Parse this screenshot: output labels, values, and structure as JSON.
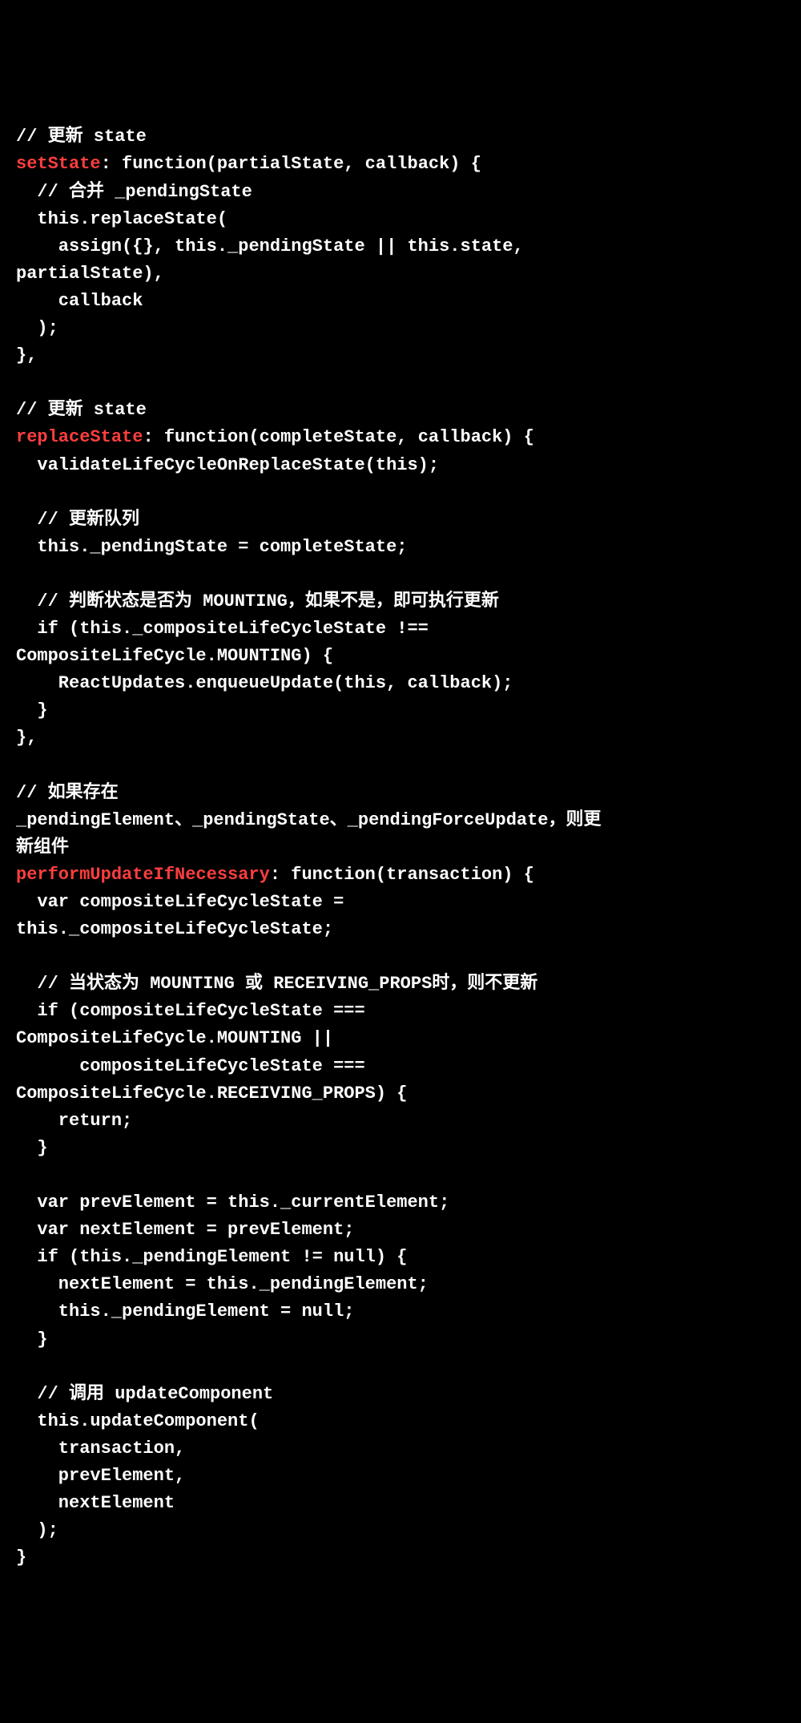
{
  "code": {
    "lines": [
      {
        "type": "comment",
        "text": "// 更新 state"
      },
      {
        "type": "method-decl",
        "method": "setState",
        "rest": ": function(partialState, callback) {"
      },
      {
        "type": "comment-indent",
        "text": "  // 合并 _pendingState"
      },
      {
        "type": "plain",
        "text": "  this.replaceState("
      },
      {
        "type": "plain",
        "text": "    assign({}, this._pendingState || this.state,"
      },
      {
        "type": "plain",
        "text": "partialState),"
      },
      {
        "type": "plain",
        "text": "    callback"
      },
      {
        "type": "plain",
        "text": "  );"
      },
      {
        "type": "plain",
        "text": "},"
      },
      {
        "type": "blank",
        "text": ""
      },
      {
        "type": "comment",
        "text": "// 更新 state"
      },
      {
        "type": "method-decl",
        "method": "replaceState",
        "rest": ": function(completeState, callback) {"
      },
      {
        "type": "plain",
        "text": "  validateLifeCycleOnReplaceState(this);"
      },
      {
        "type": "blank",
        "text": ""
      },
      {
        "type": "comment-indent",
        "text": "  // 更新队列"
      },
      {
        "type": "plain",
        "text": "  this._pendingState = completeState;"
      },
      {
        "type": "blank",
        "text": ""
      },
      {
        "type": "comment-indent",
        "text": "  // 判断状态是否为 MOUNTING，如果不是，即可执行更新"
      },
      {
        "type": "plain",
        "text": "  if (this._compositeLifeCycleState !=="
      },
      {
        "type": "plain",
        "text": "CompositeLifeCycle.MOUNTING) {"
      },
      {
        "type": "plain",
        "text": "    ReactUpdates.enqueueUpdate(this, callback);"
      },
      {
        "type": "plain",
        "text": "  }"
      },
      {
        "type": "plain",
        "text": "},"
      },
      {
        "type": "blank",
        "text": ""
      },
      {
        "type": "comment",
        "text": "// 如果存在"
      },
      {
        "type": "comment",
        "text": "_pendingElement、_pendingState、_pendingForceUpdate，则更"
      },
      {
        "type": "comment",
        "text": "新组件"
      },
      {
        "type": "method-decl",
        "method": "performUpdateIfNecessary",
        "rest": ": function(transaction) {"
      },
      {
        "type": "plain",
        "text": "  var compositeLifeCycleState ="
      },
      {
        "type": "plain",
        "text": "this._compositeLifeCycleState;"
      },
      {
        "type": "blank",
        "text": ""
      },
      {
        "type": "comment-indent",
        "text": "  // 当状态为 MOUNTING 或 RECEIVING_PROPS时，则不更新"
      },
      {
        "type": "plain",
        "text": "  if (compositeLifeCycleState ==="
      },
      {
        "type": "plain",
        "text": "CompositeLifeCycle.MOUNTING ||"
      },
      {
        "type": "plain",
        "text": "      compositeLifeCycleState ==="
      },
      {
        "type": "plain",
        "text": "CompositeLifeCycle.RECEIVING_PROPS) {"
      },
      {
        "type": "plain",
        "text": "    return;"
      },
      {
        "type": "plain",
        "text": "  }"
      },
      {
        "type": "blank",
        "text": ""
      },
      {
        "type": "plain",
        "text": "  var prevElement = this._currentElement;"
      },
      {
        "type": "plain",
        "text": "  var nextElement = prevElement;"
      },
      {
        "type": "plain",
        "text": "  if (this._pendingElement != null) {"
      },
      {
        "type": "plain",
        "text": "    nextElement = this._pendingElement;"
      },
      {
        "type": "plain",
        "text": "    this._pendingElement = null;"
      },
      {
        "type": "plain",
        "text": "  }"
      },
      {
        "type": "blank",
        "text": ""
      },
      {
        "type": "comment-indent",
        "text": "  // 调用 updateComponent"
      },
      {
        "type": "plain",
        "text": "  this.updateComponent("
      },
      {
        "type": "plain",
        "text": "    transaction,"
      },
      {
        "type": "plain",
        "text": "    prevElement,"
      },
      {
        "type": "plain",
        "text": "    nextElement"
      },
      {
        "type": "plain",
        "text": "  );"
      },
      {
        "type": "plain",
        "text": "}"
      }
    ]
  }
}
